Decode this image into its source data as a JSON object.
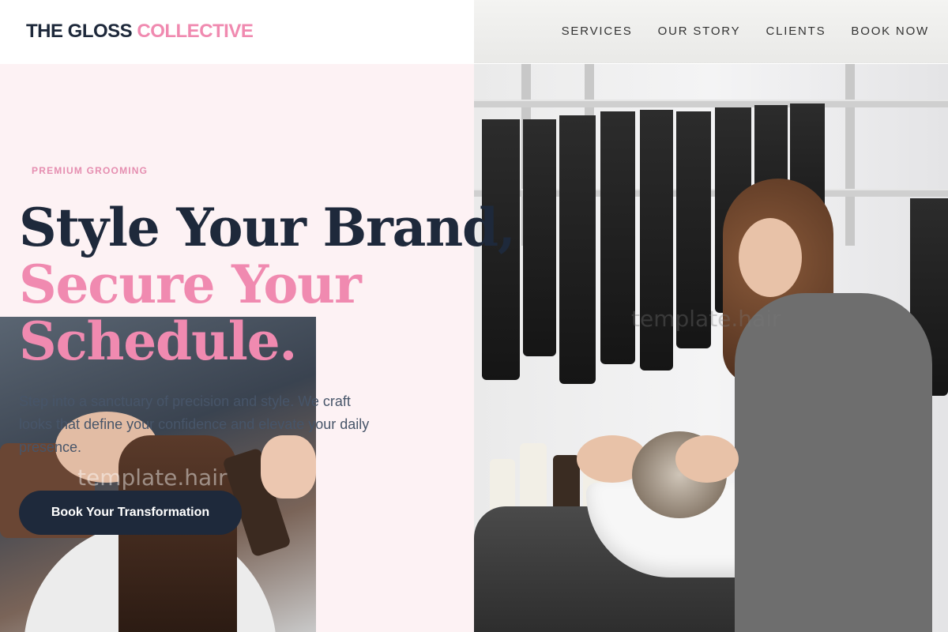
{
  "brand": {
    "name": "THE GLOSS",
    "accent": "COLLECTIVE",
    "accent_color": "#f08ab0",
    "dark_color": "#1e293b"
  },
  "nav": {
    "items": [
      {
        "label": "SERVICES"
      },
      {
        "label": "OUR STORY"
      },
      {
        "label": "CLIENTS"
      },
      {
        "label": "BOOK NOW"
      }
    ]
  },
  "hero": {
    "eyebrow": "PREMIUM GROOMING",
    "headline_line1": "Style Your Brand,",
    "headline_line2": "Secure Your",
    "headline_line3": "Schedule.",
    "description": "Step into a sanctuary of precision and style. We craft looks that define your confidence and elevate your daily presence.",
    "cta_label": "Book Your Transformation"
  },
  "images": {
    "main_photo": {
      "watermark": "template.hair"
    },
    "inset_photo": {
      "watermark": "template.hair"
    }
  }
}
